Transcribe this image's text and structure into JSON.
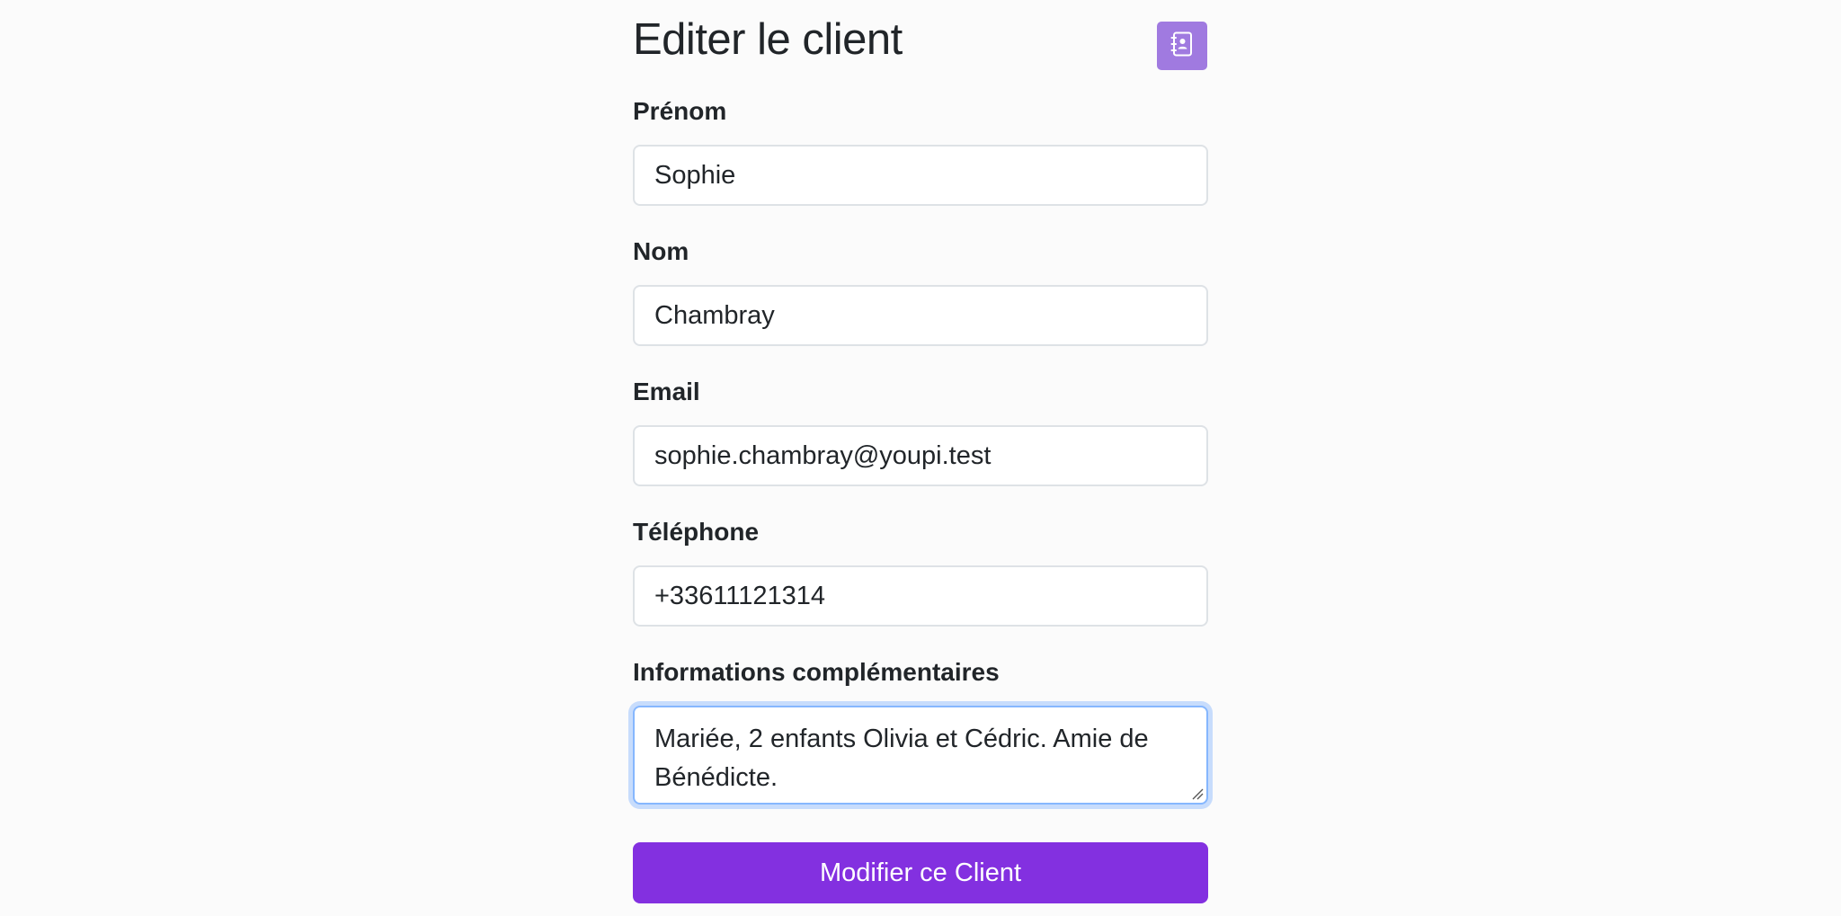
{
  "page": {
    "title": "Editer le client",
    "header_icon": "address-book-icon"
  },
  "form": {
    "first_name": {
      "label": "Prénom",
      "value": "Sophie"
    },
    "last_name": {
      "label": "Nom",
      "value": "Chambray"
    },
    "email": {
      "label": "Email",
      "value": "sophie.chambray@youpi.test"
    },
    "phone": {
      "label": "Téléphone",
      "value": "+33611121314"
    },
    "notes": {
      "label": "Informations complémentaires",
      "value": "Mariée, 2 enfants Olivia et Cédric. Amie de Bénédicte."
    },
    "submit_label": "Modifier ce Client"
  },
  "colors": {
    "accent": "#8330e0",
    "icon_button": "#a07ae0",
    "focus_border": "#86b7fe"
  }
}
